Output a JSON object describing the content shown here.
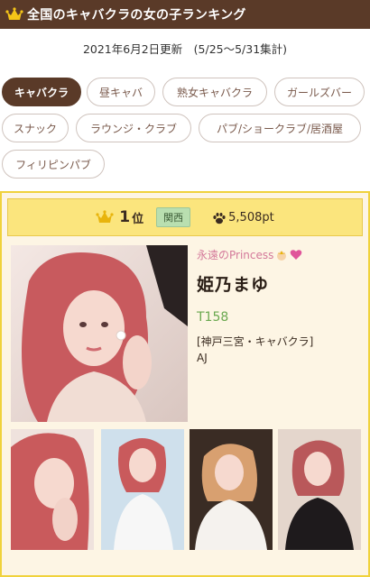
{
  "header": {
    "title": "全国のキャバクラの女の子ランキング",
    "crown_icon": "crown-icon"
  },
  "updated_text": "2021年6月2日更新　(5/25〜5/31集計)",
  "categories": [
    {
      "label": "キャバクラ",
      "active": true
    },
    {
      "label": "昼キャバ",
      "active": false
    },
    {
      "label": "熟女キャバクラ",
      "active": false
    },
    {
      "label": "ガールズバー",
      "active": false
    },
    {
      "label": "スナック",
      "active": false
    },
    {
      "label": "ラウンジ・クラブ",
      "active": false
    },
    {
      "label": "パブ/ショークラブ/居酒屋",
      "active": false
    },
    {
      "label": "フィリピンパブ",
      "active": false
    }
  ],
  "ranking": {
    "rank_number": "1",
    "rank_suffix": "位",
    "region": "関西",
    "points": "5,508pt",
    "catchphrase": "永遠のPrincess",
    "name": "姫乃まゆ",
    "height": "T158",
    "shop": "[神戸三宮・キャバクラ]",
    "group": "AJ"
  },
  "colors": {
    "header_bg": "#5a3a28",
    "active_chip": "#5a3a28",
    "card_border": "#f0d23c",
    "rank_bar": "#fbe57d",
    "region_badge": "#b9dfb0",
    "catch_pink": "#d4799a",
    "height_green": "#6aa84f"
  }
}
